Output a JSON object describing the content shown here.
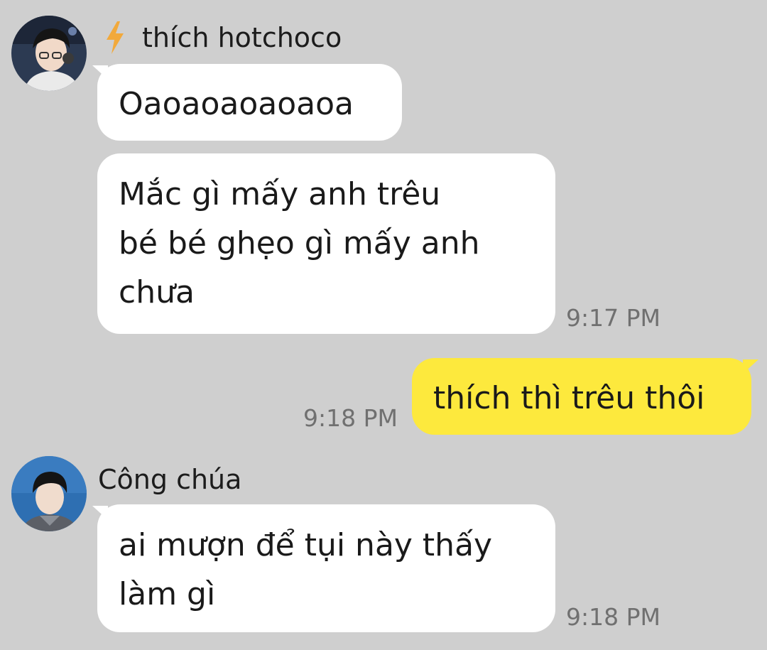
{
  "messages": [
    {
      "sender": "thích hotchoco",
      "avatar_icon": "user-avatar-photo",
      "badge_icon": "lightning-bolt-icon",
      "bubbles": [
        {
          "lines": [
            "Oaoaoaoaoaoa"
          ]
        },
        {
          "lines": [
            "Mắc gì mấy anh trêu",
            "bé bé ghẹo gì mấy anh",
            "chưa"
          ],
          "time": "9:17 PM"
        }
      ]
    },
    {
      "sender": "me",
      "bubbles": [
        {
          "lines": [
            "thích thì trêu thôi"
          ],
          "time": "9:18 PM"
        }
      ]
    },
    {
      "sender": "Công chúa",
      "avatar_icon": "user-avatar-photo",
      "bubbles": [
        {
          "lines": [
            "ai mượn để tụi này thấy",
            "làm gì"
          ],
          "time": "9:18 PM"
        }
      ]
    }
  ],
  "colors": {
    "background": "#cfcfcf",
    "incoming_bubble": "#ffffff",
    "outgoing_bubble": "#fde93d",
    "timestamp": "#707070"
  }
}
